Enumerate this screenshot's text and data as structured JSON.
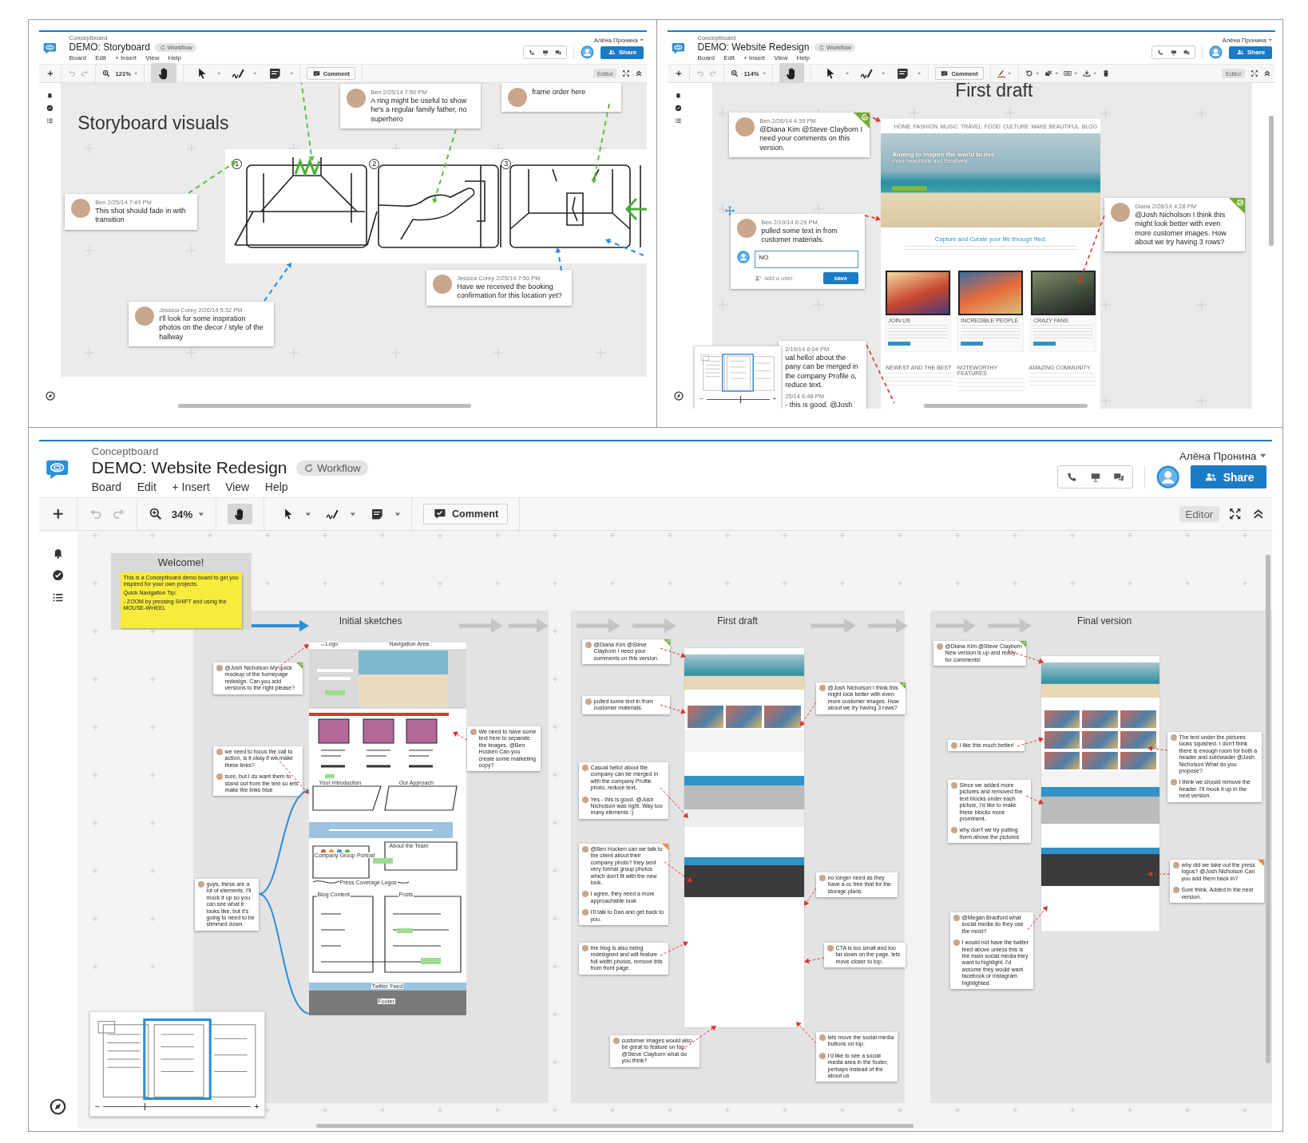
{
  "panels": [
    {
      "brand": "Conceptboard",
      "title": "DEMO: Storyboard",
      "workflow_badge": "Workflow",
      "menu": [
        "Board",
        "Edit",
        "+ Insert",
        "View",
        "Help"
      ],
      "user_name": "Алёна Пронина",
      "share_button": "Share",
      "zoom_level": "121%",
      "comment_button": "Comment",
      "mode_badge": "Editor",
      "tools": [
        {
          "kind": "hand",
          "selected": true
        },
        {
          "kind": "pointer",
          "selected": false
        },
        {
          "kind": "pen",
          "selected": false
        },
        {
          "kind": "note",
          "selected": false
        }
      ],
      "canvas": {
        "items": [
          {
            "kind": "heading",
            "text": "Storyboard visuals"
          },
          {
            "kind": "storyboard_sketch",
            "frame_numbers": [
              "1",
              "2",
              "3"
            ]
          },
          {
            "kind": "comment",
            "resolved": false,
            "messages": [
              {
                "meta": "Ben 2/25/14 7:50 PM",
                "text": "A ring might be useful to show he's a regular family father, no superhero"
              }
            ]
          },
          {
            "kind": "comment",
            "resolved": false,
            "messages": [
              {
                "text": "frame order here"
              }
            ]
          },
          {
            "kind": "comment",
            "resolved": false,
            "messages": [
              {
                "meta": "Ben 2/25/14 7:49 PM",
                "text": "This shot should fade in with transition"
              }
            ]
          },
          {
            "kind": "comment",
            "resolved": false,
            "messages": [
              {
                "meta": "Jessica Corey 2/26/14 5:32 PM",
                "text": "I'll look for some inspiration photos on the decor / style of the hallway"
              }
            ]
          },
          {
            "kind": "comment",
            "resolved": false,
            "messages": [
              {
                "meta": "Jessica Corey 2/25/14 7:50 PM",
                "text": "Have we received the booking confirmation for this location yet?"
              }
            ]
          }
        ]
      }
    },
    {
      "brand": "Conceptboard",
      "title": "DEMO: Website Redesign",
      "workflow_badge": "Workflow",
      "menu": [
        "Board",
        "Edit",
        "+ Insert",
        "View",
        "Help"
      ],
      "user_name": "Алёна Пронина",
      "share_button": "Share",
      "zoom_level": "114%",
      "comment_button": "Comment",
      "mode_badge": "Editor",
      "extra_tools": true,
      "tools": [
        {
          "kind": "hand",
          "selected": true
        },
        {
          "kind": "pointer",
          "selected": false
        },
        {
          "kind": "pen",
          "selected": false
        },
        {
          "kind": "note",
          "selected": false
        }
      ],
      "canvas": {
        "items": [
          {
            "kind": "heading",
            "text": "First draft"
          },
          {
            "kind": "website_mockup",
            "nav": [
              "HOME",
              "FASHION",
              "MUSIC",
              "TRAVEL",
              "FOOD",
              "CULTURE",
              "MAKE BEAUTIFUL",
              "BLOG"
            ],
            "hero_text": "Aiming to inspire the world to live",
            "hero_subtext": "more beautifully and creatively",
            "tagline": "Capture and Curate your life through Red.",
            "cards": [
              "JOIN US",
              "INCREDIBLE PEOPLE",
              "CRAZY FANS"
            ],
            "features": [
              "NEWEST AND THE BEST",
              "NOTEWORTHY FEATURES",
              "AMAZING COMMUNITY"
            ]
          },
          {
            "kind": "comment",
            "resolved": true,
            "messages": [
              {
                "meta": "Ben 2/26/14 4:39 PM",
                "text": "@Diana Kim @Steve Clayborn I need your comments on this version."
              }
            ]
          },
          {
            "kind": "comment",
            "resolved": false,
            "messages": [
              {
                "meta": "Ben 2/19/14 6:29 PM",
                "text": "pulled some text in from customer materials."
              }
            ],
            "reply": {
              "value": "NO",
              "add_user": "add a user",
              "save_button": "save"
            }
          },
          {
            "kind": "comment",
            "resolved": true,
            "messages": [
              {
                "meta": "Diana 2/26/14 4:28 PM",
                "text": "@Josh Nicholson I think this might look better with even more customer images. How about we try having 3 rows?"
              }
            ]
          },
          {
            "kind": "comment",
            "resolved": false,
            "messages": [
              {
                "meta": "2/19/14 6:04 PM",
                "text": "ual hello! about the pany can be merged in the company Profile o, reduce text."
              },
              {
                "meta": "25/14 6:48 PM",
                "text": "- this is good. @Josh"
              }
            ]
          },
          {
            "kind": "minimap",
            "zoom_out": "−",
            "zoom_in": "+",
            "level": 0.54
          }
        ]
      }
    },
    {
      "brand": "Conceptboard",
      "title": "DEMO: Website Redesign",
      "workflow_badge": "Workflow",
      "menu": [
        "Board",
        "Edit",
        "+ Insert",
        "View",
        "Help"
      ],
      "user_name": "Алёна Пронина",
      "share_button": "Share",
      "zoom_level": "34%",
      "comment_button": "Comment",
      "mode_badge": "Editor",
      "tools": [
        {
          "kind": "hand",
          "selected": true
        },
        {
          "kind": "pointer",
          "selected": false
        },
        {
          "kind": "pen",
          "selected": false
        },
        {
          "kind": "note",
          "selected": false
        }
      ],
      "canvas": {
        "items": [
          {
            "kind": "welcome_note",
            "title": "Welcome!",
            "note_lines": [
              "This is a Conceptboard demo board to get you inspired for your own projects.",
              "Quick Navigation Tip:",
              "- ZOOM by pressing SHIFT and using the MOUSE-WHEEL"
            ]
          },
          {
            "kind": "section",
            "title": "Initial sketches"
          },
          {
            "kind": "section",
            "title": "First draft"
          },
          {
            "kind": "section",
            "title": "Final version"
          },
          {
            "kind": "wireframe_sketch",
            "labels": [
              "Logo",
              "Navigation Area",
              "Your Introduction",
              "Our Approach",
              "Company Group Portrait",
              "About the Team",
              "Press Coverage Logos",
              "Blog Content",
              "Posts",
              "Twitter Feed",
              "Footer"
            ]
          },
          {
            "kind": "draft_page_drawing"
          },
          {
            "kind": "final_page_drawing"
          },
          {
            "kind": "comment",
            "resolved": true,
            "flagged": false,
            "messages": [
              {
                "text": "@Josh Nicholson My quick mockup of the homepage redesign. Can you add versions to the right please?"
              }
            ]
          },
          {
            "kind": "comment",
            "resolved": false,
            "flagged": false,
            "messages": [
              {
                "text": "we need to focus the call to action, is it okay if we make these links?"
              },
              {
                "text": "sure, but I do want them to stand out from the text so lets make the links blue"
              }
            ]
          },
          {
            "kind": "comment",
            "resolved": false,
            "flagged": false,
            "messages": [
              {
                "text": "We need to have some text here to separate the images. @Ben Hocken Can you create some marketing copy?"
              }
            ]
          },
          {
            "kind": "comment",
            "resolved": false,
            "flagged": false,
            "messages": [
              {
                "text": "guys, these are a lot of elements. I'll mock it up so you can see what it looks like, but it's going to need to be slimmed down."
              }
            ]
          },
          {
            "kind": "comment",
            "resolved": true,
            "flagged": false,
            "messages": [
              {
                "text": "@Diana Kim @Steve Clayborn I need your comments on this version."
              }
            ]
          },
          {
            "kind": "comment",
            "resolved": false,
            "flagged": false,
            "messages": [
              {
                "text": "pulled some text in from customer materials."
              }
            ]
          },
          {
            "kind": "comment",
            "resolved": true,
            "flagged": false,
            "messages": [
              {
                "text": "@Josh Nicholson I think this might look better with even more customer images. How about we try having 3 rows?"
              }
            ]
          },
          {
            "kind": "comment",
            "resolved": false,
            "flagged": false,
            "messages": [
              {
                "text": "Casual hello! about the company can be merged in with the company Profile photo, reduce text."
              },
              {
                "text": "Yes - this is good. @Josh Nicholson was right. Way too many elements :)"
              }
            ]
          },
          {
            "kind": "comment",
            "resolved": false,
            "flagged": true,
            "messages": [
              {
                "text": "@Ben Hocken can we talk to the client about their company photo? they sent very formal group photos which don't fit with the new look."
              },
              {
                "text": "I agree, they need a more approachable look"
              },
              {
                "text": "I'll talk to Dan and get back to you."
              }
            ]
          },
          {
            "kind": "comment",
            "resolved": false,
            "flagged": false,
            "messages": [
              {
                "text": "no longer need as they have a cc free that for the storage plans."
              }
            ]
          },
          {
            "kind": "comment",
            "resolved": false,
            "flagged": false,
            "messages": [
              {
                "text": "the blog is also being redesigned and will feature full width photos, remove this from front page."
              }
            ]
          },
          {
            "kind": "comment",
            "resolved": false,
            "flagged": false,
            "messages": [
              {
                "text": "CTA is too small and too far down on the page. lets move closer to top."
              }
            ]
          },
          {
            "kind": "comment",
            "resolved": false,
            "flagged": false,
            "messages": [
              {
                "text": "customer images would also be great to feature on top. @Steve Clayborn what do you think?"
              }
            ]
          },
          {
            "kind": "comment",
            "resolved": false,
            "flagged": false,
            "messages": [
              {
                "text": "lets move the social media buttons on top."
              },
              {
                "text": "I'd like to see a social media area in the footer, perhaps instead of the about us"
              }
            ]
          },
          {
            "kind": "comment",
            "resolved": true,
            "flagged": false,
            "messages": [
              {
                "text": "@Diana Kim @Steve Clayborn New version is up and ready for comments!"
              }
            ]
          },
          {
            "kind": "comment",
            "resolved": false,
            "flagged": false,
            "messages": [
              {
                "text": "I like this much better!"
              }
            ]
          },
          {
            "kind": "comment",
            "resolved": false,
            "flagged": false,
            "messages": [
              {
                "text": "The text under the pictures looks squished. I don't think there is enough room for both a header and subheader @Josh Nicholson What do you propose?"
              },
              {
                "text": "I think we should remove the header. I'll mock it up in the next version."
              }
            ]
          },
          {
            "kind": "comment",
            "resolved": false,
            "flagged": false,
            "messages": [
              {
                "text": "Since we added more pictures and removed the text blocks under each picture, I'd like to make these blocks more prominent."
              },
              {
                "text": "why don't we try putting them above the pictures"
              }
            ]
          },
          {
            "kind": "comment",
            "resolved": false,
            "flagged": true,
            "messages": [
              {
                "text": "why did we take out the press logos? @Josh Nicholson Can you add them back in?"
              },
              {
                "text": "Sure think. Added in the next version."
              }
            ]
          },
          {
            "kind": "comment",
            "resolved": false,
            "flagged": false,
            "messages": [
              {
                "text": "@Megan Bradford what social media do they use the most?"
              },
              {
                "text": "I would not have the twitter feed above unless this is the main social media they want to highlight. I'd assume they would want facebook or instagram highlighted."
              }
            ]
          },
          {
            "kind": "minimap",
            "zoom_out": "−",
            "zoom_in": "+",
            "level": 0.28
          }
        ]
      }
    }
  ]
}
